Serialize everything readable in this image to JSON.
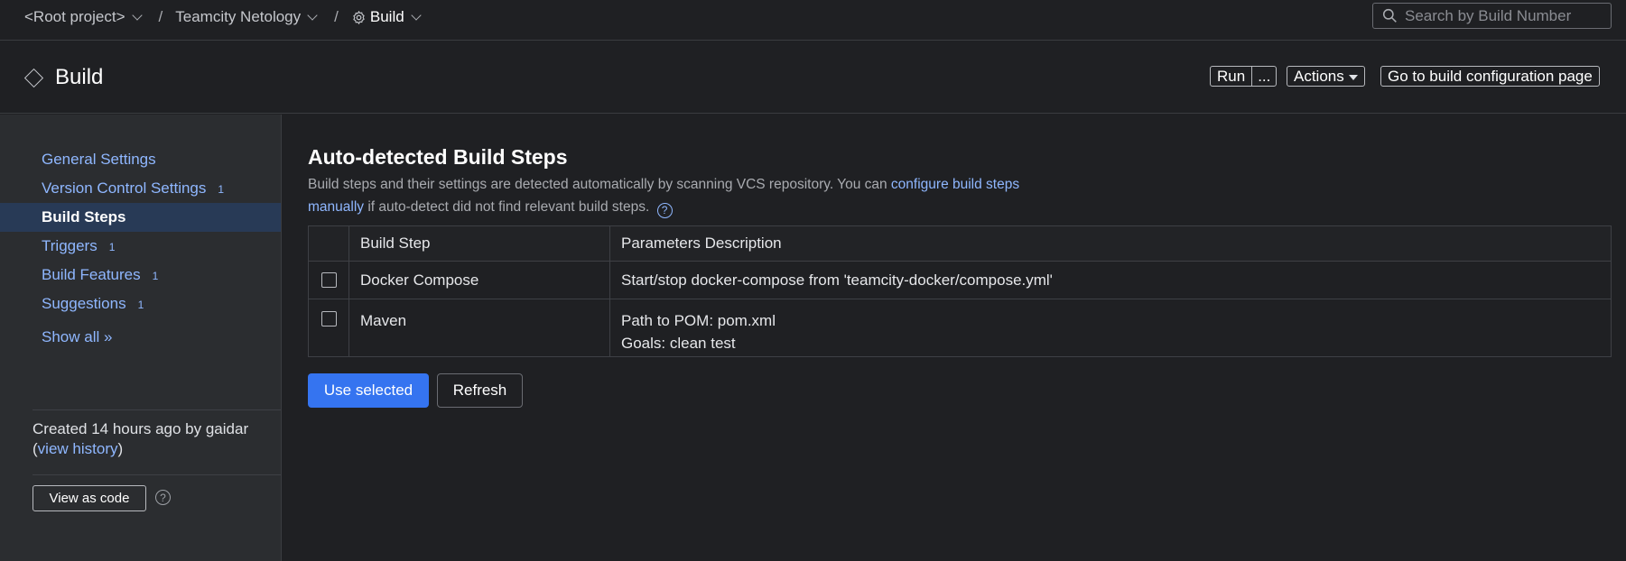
{
  "breadcrumb": {
    "items": [
      "<Root project>",
      "Teamcity Netology",
      "Build"
    ],
    "separator": "/"
  },
  "search": {
    "placeholder": "Search by Build Number"
  },
  "header": {
    "title": "Build",
    "run_label": "Run",
    "run_more_label": "...",
    "actions_label": "Actions",
    "goto_label": "Go to build configuration page"
  },
  "sidebar": {
    "items": [
      {
        "label": "General Settings",
        "count": ""
      },
      {
        "label": "Version Control Settings",
        "count": "1"
      },
      {
        "label": "Build Steps",
        "count": ""
      },
      {
        "label": "Triggers",
        "count": "1"
      },
      {
        "label": "Build Features",
        "count": "1"
      },
      {
        "label": "Suggestions",
        "count": "1"
      }
    ],
    "show_all": "Show all »",
    "created_text": "Created 14 hours ago by gaidar",
    "view_history": "view history",
    "view_as_code": "View as code",
    "help_glyph": "?"
  },
  "main": {
    "heading": "Auto-detected Build Steps",
    "desc_part1": "Build steps and their settings are detected automatically by scanning VCS repository. You can ",
    "desc_link1": "configure build steps manually",
    "desc_part2": " if auto-detect did not find relevant build steps.",
    "help_glyph": "?",
    "table": {
      "headers": [
        "",
        "Build Step",
        "Parameters Description"
      ],
      "rows": [
        {
          "step": "Docker Compose",
          "params": [
            "Start/stop docker-compose from 'teamcity-docker/compose.yml'"
          ]
        },
        {
          "step": "Maven",
          "params": [
            "Path to POM: pom.xml",
            "Goals: clean test"
          ]
        }
      ]
    },
    "use_selected": "Use selected",
    "refresh": "Refresh"
  },
  "colors": {
    "accent": "#3574f0",
    "link": "#8fb7ff",
    "background": "#1f2023",
    "sidebar": "#2b2d30"
  },
  "icons": [
    "chevron-down-icon",
    "gear-icon",
    "search-icon",
    "diamond-icon",
    "caret-down-icon",
    "help-icon",
    "checkbox-icon"
  ]
}
